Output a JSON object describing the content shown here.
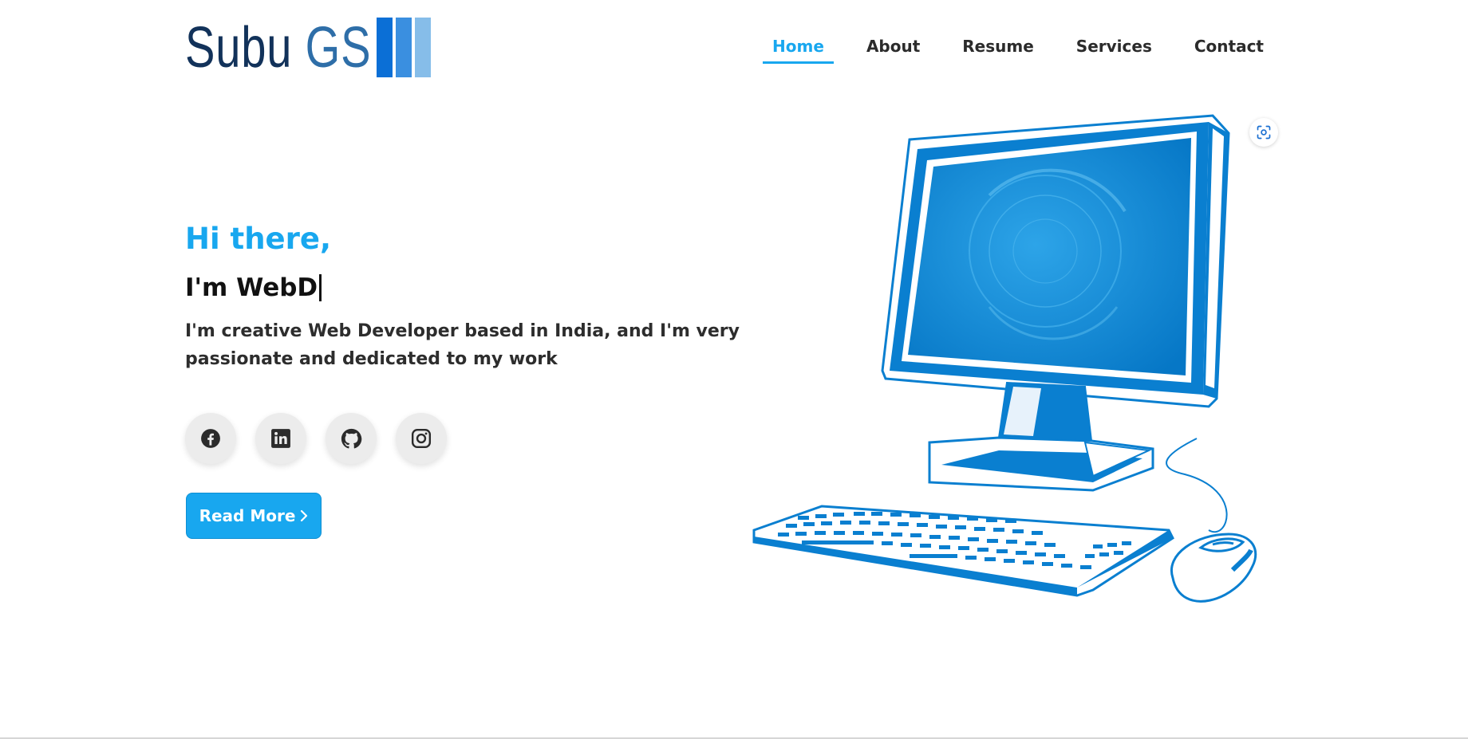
{
  "logo": {
    "first": "Subu",
    "last": "GS",
    "bar_colors": [
      "#0b6fd6",
      "#3a8fe0",
      "#86bde9"
    ]
  },
  "nav": {
    "items": [
      {
        "label": "Home",
        "active": true
      },
      {
        "label": "About",
        "active": false
      },
      {
        "label": "Resume",
        "active": false
      },
      {
        "label": "Services",
        "active": false
      },
      {
        "label": "Contact",
        "active": false
      }
    ]
  },
  "hero": {
    "greeting": "Hi there,",
    "role": "I'm WebD",
    "bio": "I'm creative Web Developer based in India, and I'm very passionate and dedicated to my work",
    "read_more": "Read More"
  },
  "socials": [
    {
      "icon": "facebook-icon"
    },
    {
      "icon": "linkedin-icon"
    },
    {
      "icon": "github-icon"
    },
    {
      "icon": "instagram-icon"
    }
  ],
  "colors": {
    "accent": "#18a7ef",
    "illustration": "#0a7fd0",
    "text": "#2d2d2d"
  }
}
